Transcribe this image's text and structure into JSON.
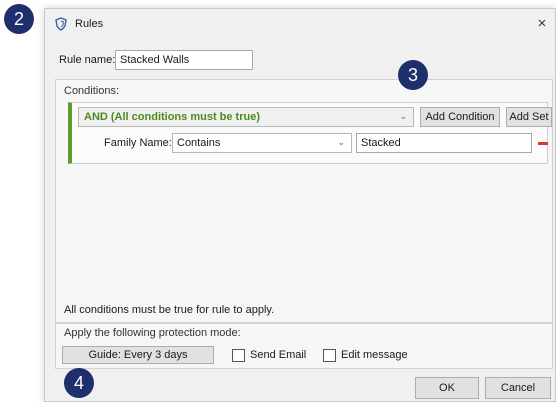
{
  "window": {
    "title": "Rules",
    "close_label": "×"
  },
  "rule_name": {
    "label": "Rule name:",
    "value": "Stacked Walls"
  },
  "conditions": {
    "group_label": "Conditions:",
    "operator": "AND (All conditions must be true)",
    "add_condition_label": "Add Condition",
    "add_set_label": "Add Set",
    "condition": {
      "field_label": "Family Name:",
      "comparator": "Contains",
      "value": "Stacked"
    },
    "note": "All conditions must be true for rule to apply."
  },
  "protection": {
    "group_label": "Apply the following protection mode:",
    "mode_button": "Guide: Every 3 days",
    "send_email_label": "Send Email",
    "edit_message_label": "Edit message"
  },
  "footer": {
    "ok_label": "OK",
    "cancel_label": "Cancel"
  },
  "callouts": {
    "a": "2",
    "b": "3",
    "c": "4"
  },
  "colors": {
    "operator_green": "#4c8a1f",
    "set_border_green": "#5e9c2f",
    "remove_red": "#d23a2f",
    "badge_navy": "#1f2f6e"
  },
  "icons": {
    "app": "shield-icon",
    "dropdown": "chevron-down-icon",
    "remove": "minus-icon"
  }
}
